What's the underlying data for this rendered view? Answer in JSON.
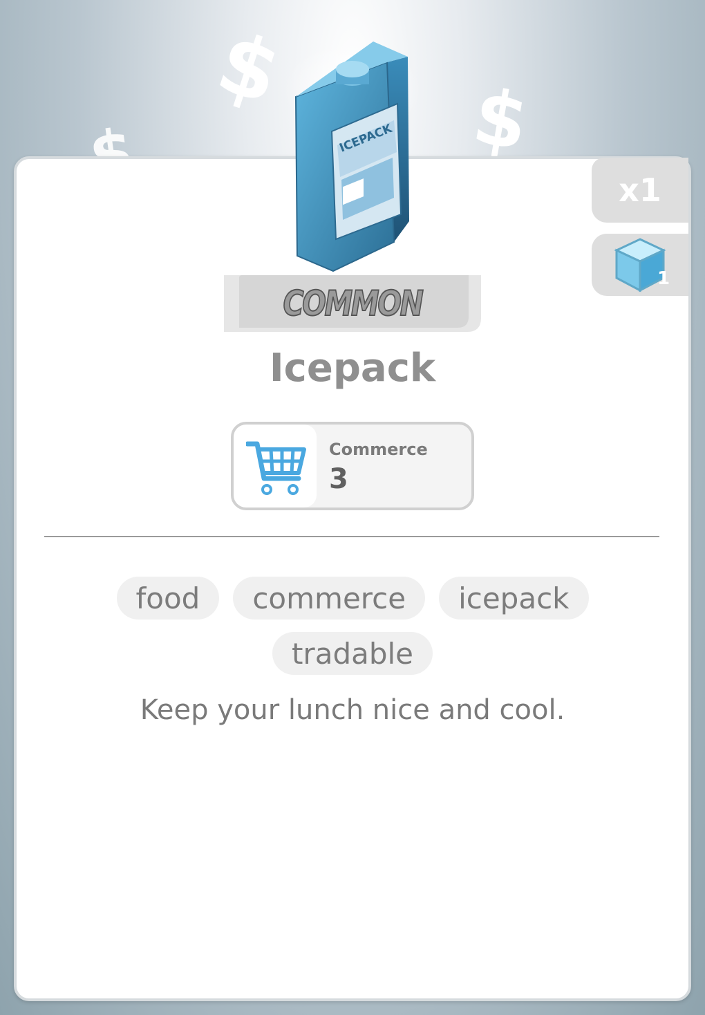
{
  "item": {
    "name": "Icepack",
    "rarity": "COMMON",
    "quantity": "x1",
    "cube_count": "1",
    "image_label": "ICEPACK"
  },
  "stat": {
    "icon": "shopping-cart-icon",
    "label": "Commerce",
    "value": "3"
  },
  "tags": [
    "food",
    "commerce",
    "icepack",
    "tradable"
  ],
  "description": "Keep your lunch nice and cool.",
  "background_symbols": [
    "$",
    "$",
    "$"
  ],
  "colors": {
    "accent_blue": "#4aa8e0",
    "card_background": "#ffffff",
    "tab_gray": "#dedede",
    "text_gray": "#8f8f8f"
  }
}
